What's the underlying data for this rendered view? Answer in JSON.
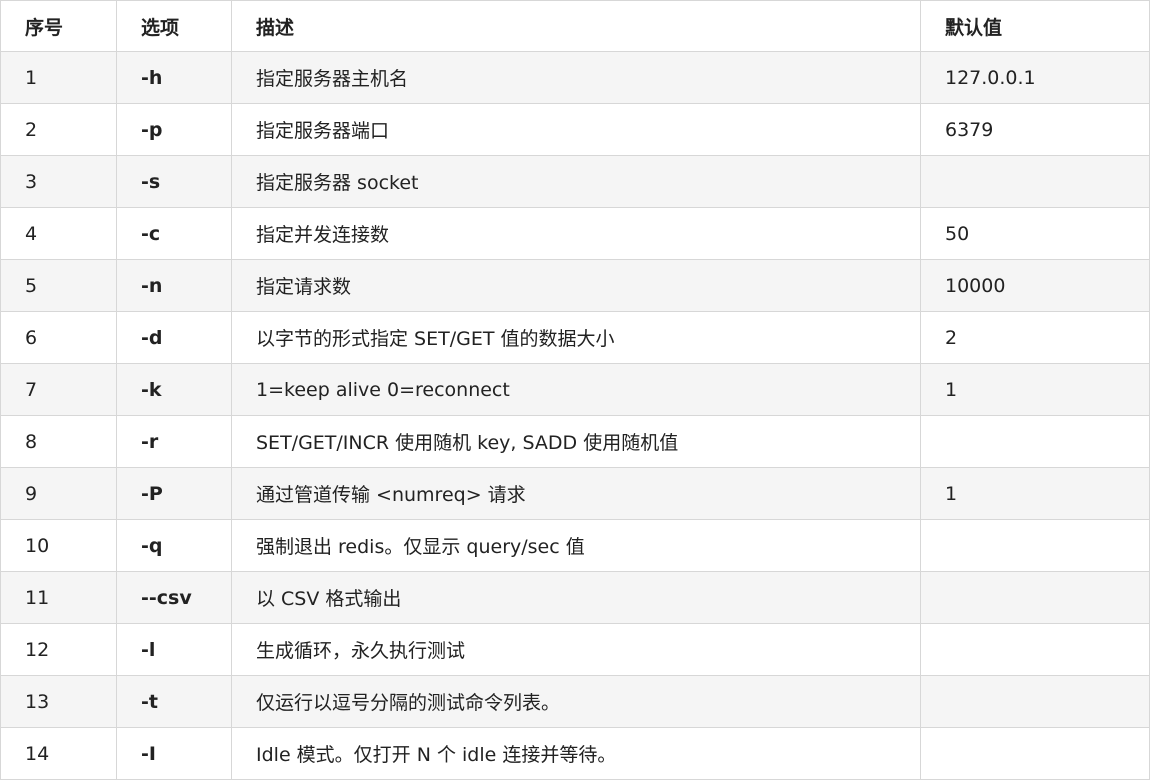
{
  "table": {
    "headers": [
      "序号",
      "选项",
      "描述",
      "默认值"
    ],
    "rows": [
      {
        "no": "1",
        "option": "-h",
        "desc": "指定服务器主机名",
        "default": "127.0.0.1"
      },
      {
        "no": "2",
        "option": "-p",
        "desc": "指定服务器端口",
        "default": "6379"
      },
      {
        "no": "3",
        "option": "-s",
        "desc": "指定服务器 socket",
        "default": ""
      },
      {
        "no": "4",
        "option": "-c",
        "desc": "指定并发连接数",
        "default": "50"
      },
      {
        "no": "5",
        "option": "-n",
        "desc": "指定请求数",
        "default": "10000"
      },
      {
        "no": "6",
        "option": "-d",
        "desc": "以字节的形式指定 SET/GET 值的数据大小",
        "default": "2"
      },
      {
        "no": "7",
        "option": "-k",
        "desc": "1=keep alive 0=reconnect",
        "default": "1"
      },
      {
        "no": "8",
        "option": "-r",
        "desc": "SET/GET/INCR 使用随机 key, SADD 使用随机值",
        "default": ""
      },
      {
        "no": "9",
        "option": "-P",
        "desc": "通过管道传输 <numreq> 请求",
        "default": "1"
      },
      {
        "no": "10",
        "option": "-q",
        "desc": "强制退出 redis。仅显示 query/sec 值",
        "default": ""
      },
      {
        "no": "11",
        "option": "--csv",
        "desc": "以 CSV 格式输出",
        "default": ""
      },
      {
        "no": "12",
        "option": "-l",
        "desc": "生成循环，永久执行测试",
        "default": ""
      },
      {
        "no": "13",
        "option": "-t",
        "desc": "仅运行以逗号分隔的测试命令列表。",
        "default": ""
      },
      {
        "no": "14",
        "option": "-I",
        "desc": "Idle 模式。仅打开 N 个 idle 连接并等待。",
        "default": ""
      }
    ]
  }
}
